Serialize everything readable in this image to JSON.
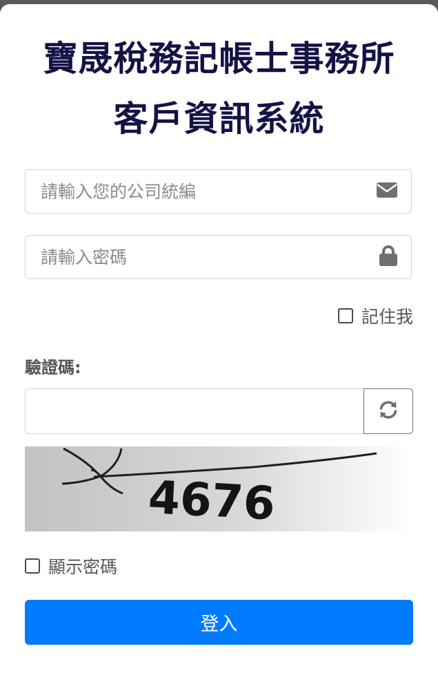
{
  "header": {
    "title_line1": "寶晟稅務記帳士事務所",
    "title_line2": "客戶資訊系統"
  },
  "form": {
    "tax_id": {
      "placeholder": "請輸入您的公司統編",
      "icon": "envelope-icon"
    },
    "password": {
      "placeholder": "請輸入密碼",
      "icon": "lock-icon"
    },
    "remember_label": "記住我",
    "captcha_label": "驗證碼:",
    "captcha_value": "",
    "refresh_icon": "refresh-icon",
    "captcha_text": "4676",
    "show_password_label": "顯示密碼",
    "submit_label": "登入"
  },
  "colors": {
    "title": "#141245",
    "primary": "#007bff",
    "icon": "#6f6f6f"
  }
}
